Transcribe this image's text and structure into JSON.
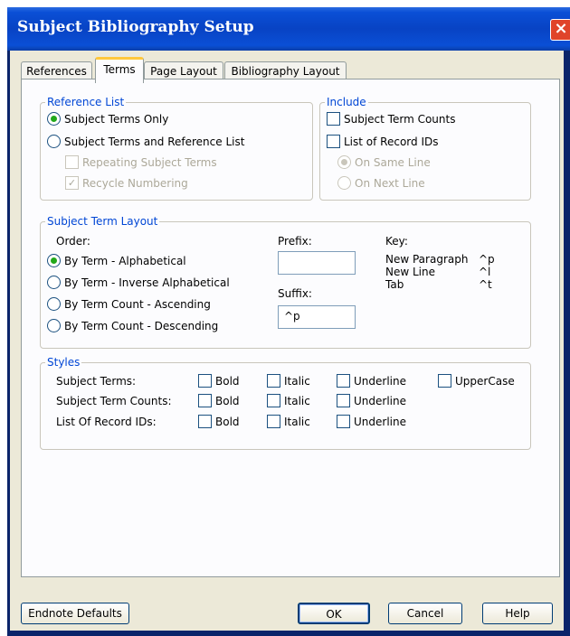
{
  "window": {
    "title": "Subject Bibliography Setup",
    "close_glyph": "×"
  },
  "tabs": [
    {
      "label": "References"
    },
    {
      "label": "Terms"
    },
    {
      "label": "Page Layout"
    },
    {
      "label": "Bibliography Layout"
    }
  ],
  "reference_list": {
    "legend": "Reference List",
    "subject_terms_only": "Subject Terms Only",
    "subject_terms_and_reference_list": "Subject Terms and Reference List",
    "repeating_subject_terms": "Repeating Subject Terms",
    "recycle_numbering": "Recycle Numbering",
    "check_glyph": "✓"
  },
  "include": {
    "legend": "Include",
    "subject_term_counts": "Subject Term Counts",
    "list_of_record_ids": "List of Record IDs",
    "on_same_line": "On Same Line",
    "on_next_line": "On Next Line"
  },
  "layout": {
    "legend": "Subject Term Layout",
    "order_label": "Order:",
    "options": [
      "By Term - Alphabetical",
      "By Term - Inverse Alphabetical",
      "By Term Count - Ascending",
      "By Term Count - Descending"
    ],
    "prefix_label": "Prefix:",
    "prefix_value": "",
    "suffix_label": "Suffix:",
    "suffix_value": "^p",
    "key_label": "Key:",
    "keys": [
      {
        "name": "New Paragraph",
        "code": "^p"
      },
      {
        "name": "New Line",
        "code": "^l"
      },
      {
        "name": "Tab",
        "code": "^t"
      }
    ]
  },
  "styles": {
    "legend": "Styles",
    "rows": [
      {
        "label": "Subject Terms:"
      },
      {
        "label": "Subject Term Counts:"
      },
      {
        "label": "List Of Record IDs:"
      }
    ],
    "bold": "Bold",
    "italic": "Italic",
    "underline": "Underline",
    "uppercase": "UpperCase"
  },
  "buttons": {
    "endnote_defaults": "Endnote Defaults",
    "ok": "OK",
    "cancel": "Cancel",
    "help": "Help"
  }
}
